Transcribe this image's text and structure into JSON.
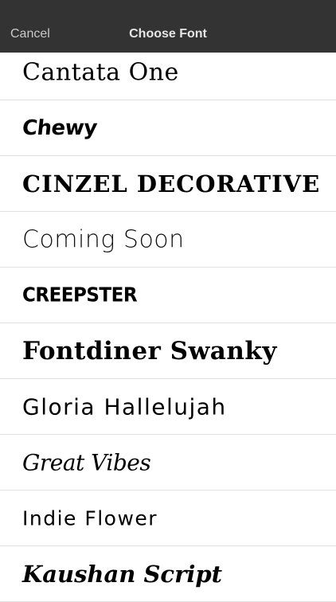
{
  "navbar": {
    "cancel_label": "Cancel",
    "title": "Choose Font"
  },
  "fonts": [
    {
      "label": "Cantata One"
    },
    {
      "label": "Chewy"
    },
    {
      "label": "CINZEL DECORATIVE"
    },
    {
      "label": "Coming Soon"
    },
    {
      "label": "CREEPSTER"
    },
    {
      "label": "Fontdiner Swanky"
    },
    {
      "label": "Gloria Hallelujah"
    },
    {
      "label": "Great Vibes"
    },
    {
      "label": "Indie Flower"
    },
    {
      "label": "Kaushan Script"
    }
  ]
}
